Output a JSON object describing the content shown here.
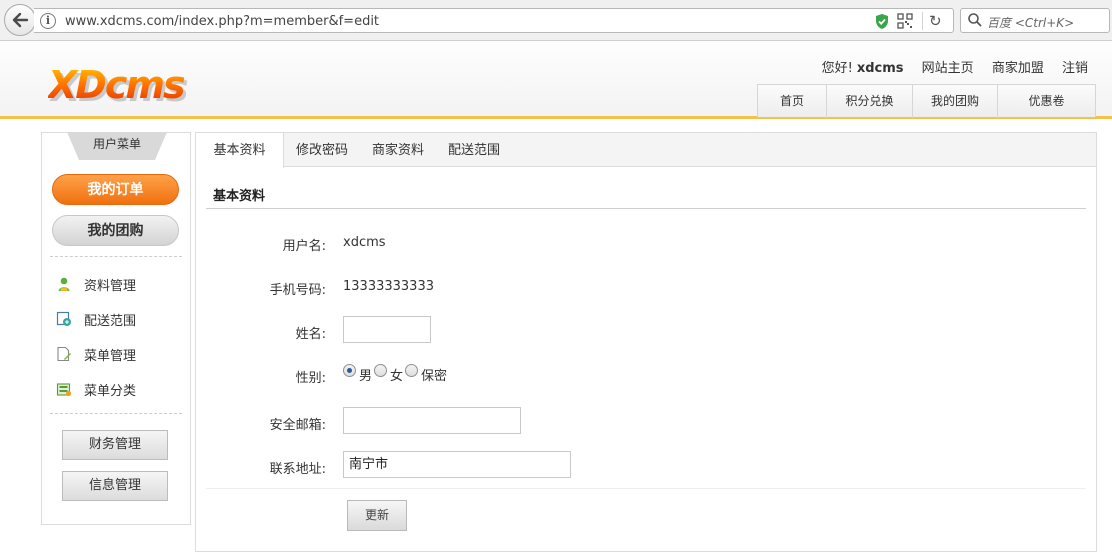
{
  "browser": {
    "url": "www.xdcms.com/index.php?m=member&f=edit",
    "search_placeholder": "百度 <Ctrl+K>"
  },
  "header": {
    "logo": "XDcms",
    "greeting": "您好!",
    "username": "xdcms",
    "links": [
      "网站主页",
      "商家加盟",
      "注销"
    ],
    "nav": [
      "首页",
      "积分兑换",
      "我的团购",
      "优惠卷"
    ],
    "accent_color": "#f6c14a"
  },
  "sidebar": {
    "title": "用户菜单",
    "primary_button": "我的订单",
    "secondary_button": "我的团购",
    "links": [
      {
        "label": "资料管理",
        "icon": "user-icon"
      },
      {
        "label": "配送范围",
        "icon": "map-icon"
      },
      {
        "label": "菜单管理",
        "icon": "document-edit-icon"
      },
      {
        "label": "菜单分类",
        "icon": "folder-icon"
      }
    ],
    "bottom_buttons": [
      "财务管理",
      "信息管理"
    ],
    "primary_color": "#f58220"
  },
  "main": {
    "tabs": [
      "基本资料",
      "修改密码",
      "商家资料",
      "配送范围"
    ],
    "active_tab": "基本资料",
    "section_title": "基本资料",
    "form": {
      "username_label": "用户名:",
      "username_value": "xdcms",
      "phone_label": "手机号码:",
      "phone_value": "13333333333",
      "name_label": "姓名:",
      "name_value": "",
      "gender_label": "性别:",
      "gender_options": [
        "男",
        "女",
        "保密"
      ],
      "gender_selected": "男",
      "email_label": "安全邮箱:",
      "email_value": "",
      "address_label": "联系地址:",
      "address_value": "南宁市",
      "submit_label": "更新"
    }
  }
}
